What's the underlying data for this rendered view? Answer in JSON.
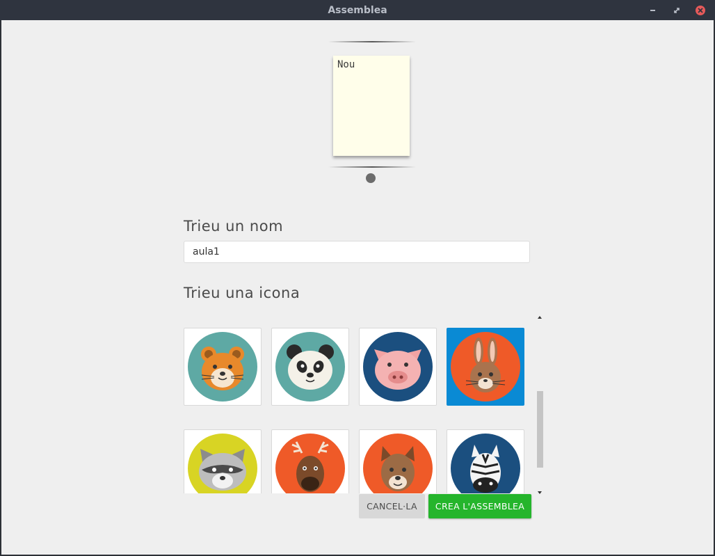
{
  "window": {
    "title": "Assemblea"
  },
  "preview": {
    "note_text": "Nou"
  },
  "name_section": {
    "heading": "Trieu un nom",
    "input_value": "aula1"
  },
  "icon_section": {
    "heading": "Trieu una icona",
    "icons": [
      {
        "name": "hamster",
        "bg": "#5ea9a4",
        "selected": false
      },
      {
        "name": "panda",
        "bg": "#5ea9a4",
        "selected": false
      },
      {
        "name": "pig",
        "bg": "#1b4f7f",
        "selected": false
      },
      {
        "name": "rabbit",
        "bg": "#ef5a28",
        "selected": true
      },
      {
        "name": "raccoon",
        "bg": "#d8d424",
        "selected": false
      },
      {
        "name": "moose",
        "bg": "#ef5a28",
        "selected": false
      },
      {
        "name": "dog",
        "bg": "#ef5a28",
        "selected": false
      },
      {
        "name": "zebra",
        "bg": "#1b4f7f",
        "selected": false
      }
    ]
  },
  "buttons": {
    "cancel_label": "CANCEL·LA",
    "create_label": "CREA L'ASSEMBLEA"
  },
  "colors": {
    "selected_tile": "#0a8ad4",
    "create_button": "#25b52c",
    "note": "#fffeea"
  }
}
